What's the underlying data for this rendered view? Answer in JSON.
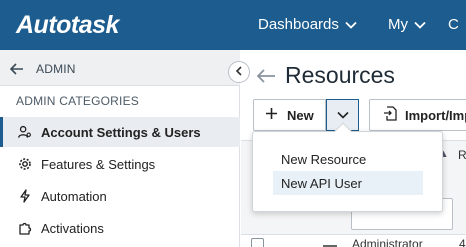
{
  "header": {
    "logo": "Autotask",
    "nav": [
      {
        "label": "Dashboards"
      },
      {
        "label": "My"
      },
      {
        "label": "C"
      }
    ]
  },
  "sidebar": {
    "back_label": "ADMIN",
    "category_heading": "ADMIN CATEGORIES",
    "items": [
      {
        "label": "Account Settings & Users",
        "icon": "user-gear-icon",
        "active": true
      },
      {
        "label": "Features & Settings",
        "icon": "gear-icon",
        "active": false
      },
      {
        "label": "Automation",
        "icon": "lightning-icon",
        "active": false
      },
      {
        "label": "Activations",
        "icon": "puzzle-icon",
        "active": false
      }
    ]
  },
  "main": {
    "title": "Resources",
    "toolbar": {
      "new_label": "New",
      "import_label": "Import/Imp"
    },
    "new_menu": [
      {
        "label": "New Resource",
        "highlighted": false
      },
      {
        "label": "New API User",
        "highlighted": true
      }
    ],
    "grid": {
      "column_partial": "R",
      "first_row_text": "Administrator",
      "first_row_extra": "4"
    }
  },
  "colors": {
    "header_bg": "#1c5c8e",
    "sidebar_active_bg": "#e9edf1",
    "menu_highlight": "#e9f1f8"
  }
}
